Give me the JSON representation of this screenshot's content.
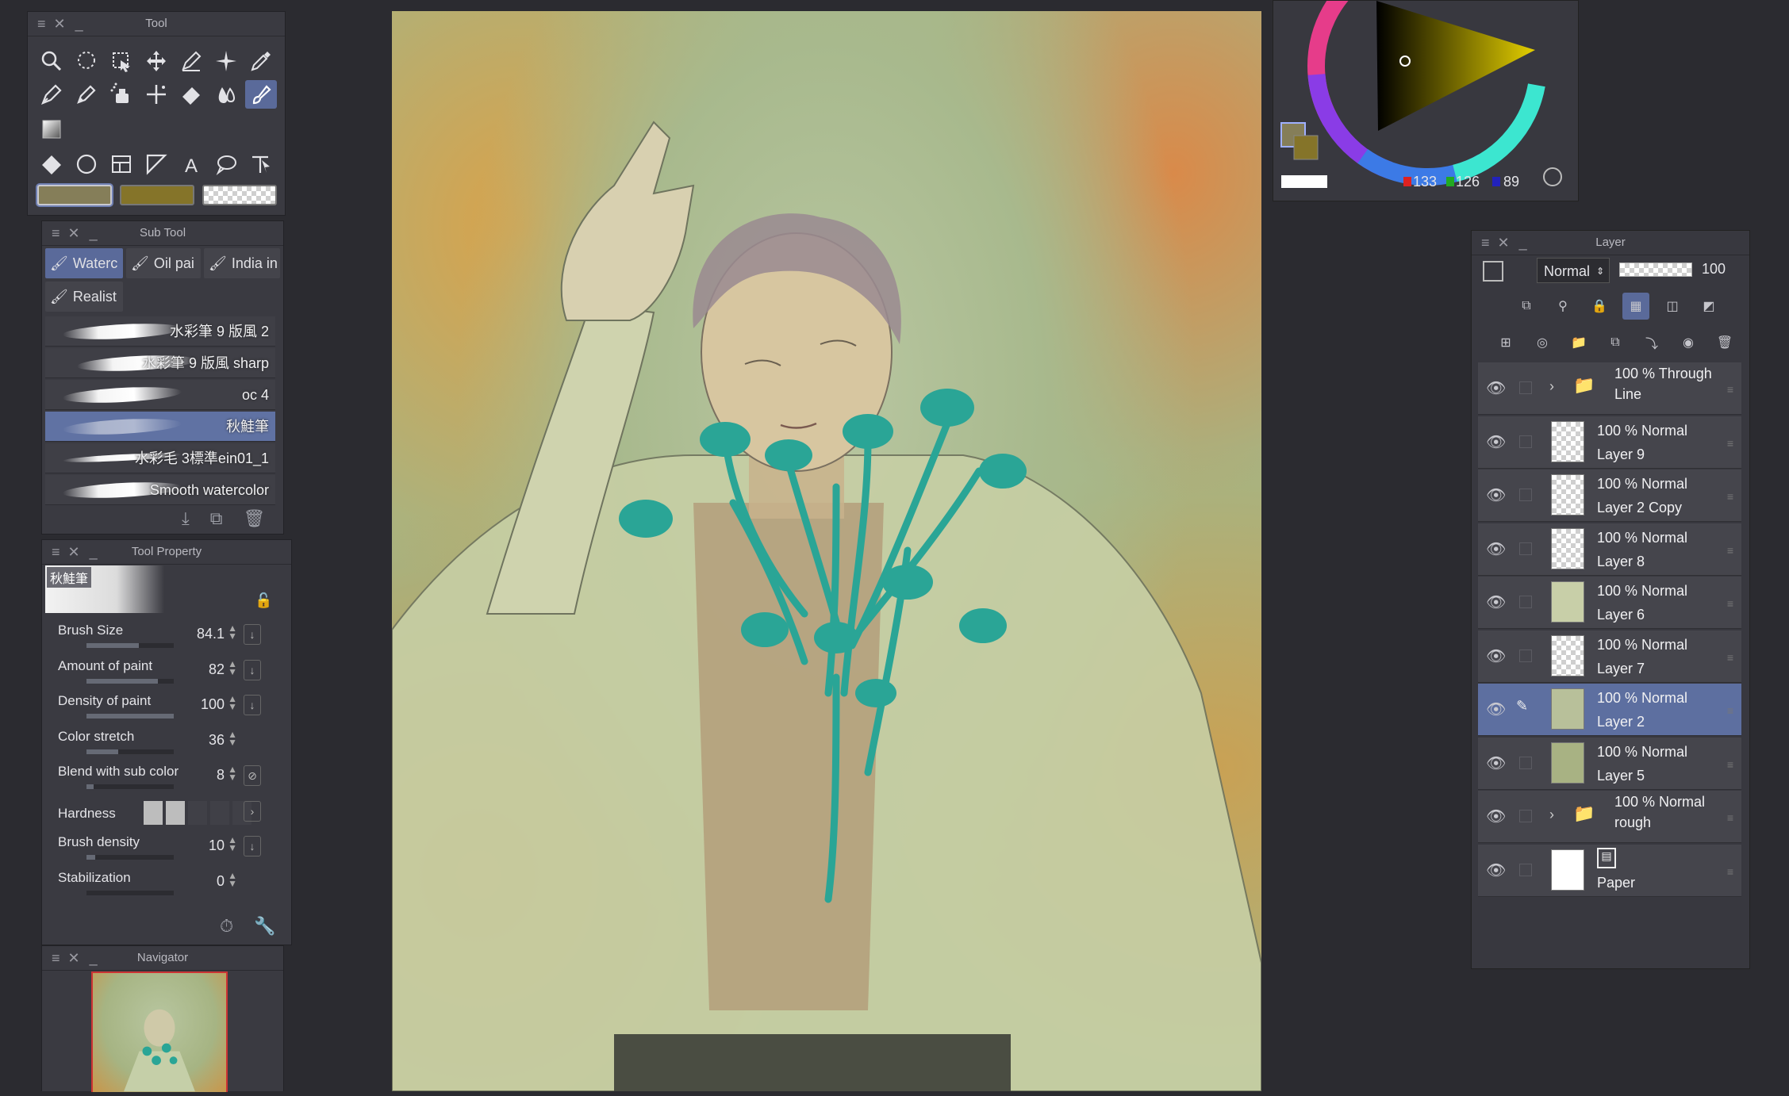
{
  "tool_panel": {
    "title": "Tool"
  },
  "subtool_panel": {
    "title": "Sub Tool",
    "tabs": [
      "Waterc",
      "Oil pai",
      "India in",
      "Realist"
    ],
    "brushes": [
      "水彩筆 9 版風 2",
      "水彩筆 9 版風 sharp",
      "oc 4",
      "秋鮭筆",
      "水彩毛 3標準ein01_1",
      "Smooth watercolor"
    ]
  },
  "tool_property": {
    "title": "Tool Property",
    "brush_name": "秋鮭筆",
    "props": [
      {
        "label": "Brush Size",
        "value": "84.1",
        "level": 0.6
      },
      {
        "label": "Amount of paint",
        "value": "82",
        "level": 0.82
      },
      {
        "label": "Density of paint",
        "value": "100",
        "level": 1.0
      },
      {
        "label": "Color stretch",
        "value": "36",
        "level": 0.36
      },
      {
        "label": "Blend with sub color",
        "value": "8",
        "level": 0.08
      },
      {
        "label": "Hardness",
        "value": "",
        "level": 0.4
      },
      {
        "label": "Brush density",
        "value": "10",
        "level": 0.1
      },
      {
        "label": "Stabilization",
        "value": "0",
        "level": 0.0
      }
    ]
  },
  "navigator": {
    "title": "Navigator"
  },
  "color_panel": {
    "r": "133",
    "g": "126",
    "b": "89",
    "main_color": "#857e59",
    "sub_color": "#857429"
  },
  "layer_panel": {
    "title": "Layer",
    "blend_mode": "Normal",
    "opacity": "100",
    "layers": [
      {
        "title": "100 % Through",
        "name": "Line",
        "type": "folder"
      },
      {
        "title": "100 % Normal",
        "name": "Layer 9",
        "type": "layer"
      },
      {
        "title": "100 % Normal",
        "name": "Layer 2 Copy",
        "type": "layer"
      },
      {
        "title": "100 % Normal",
        "name": "Layer 8",
        "type": "layer"
      },
      {
        "title": "100 % Normal",
        "name": "Layer 6",
        "type": "layer"
      },
      {
        "title": "100 % Normal",
        "name": "Layer 7",
        "type": "layer"
      },
      {
        "title": "100 % Normal",
        "name": "Layer 2",
        "type": "layer",
        "active": true
      },
      {
        "title": "100 % Normal",
        "name": "Layer 5",
        "type": "layer"
      },
      {
        "title": "100 % Normal",
        "name": "rough",
        "type": "folder"
      },
      {
        "title": "",
        "name": "Paper",
        "type": "paper"
      }
    ]
  }
}
